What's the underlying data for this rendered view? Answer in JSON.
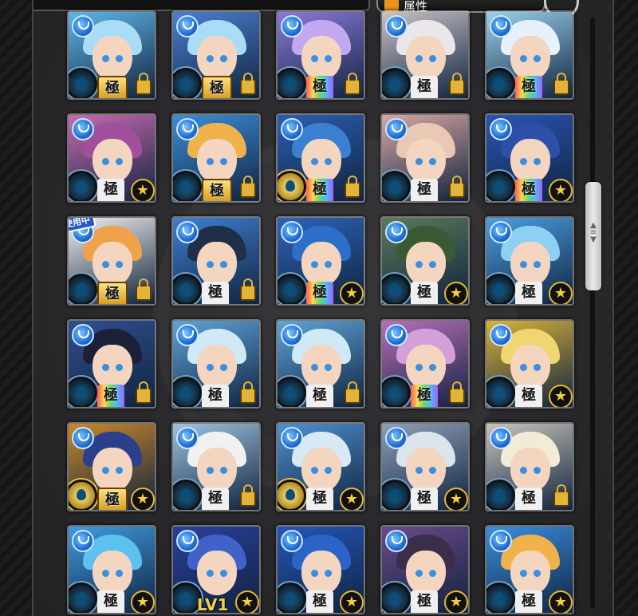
{
  "header": {
    "sort_label": "属性"
  },
  "colors": {
    "panel_bg": "#2b2b2e",
    "element_water": "#1f6dd6",
    "star": "#f6cf3a",
    "lock": "#e2b53a"
  },
  "monsters": [
    {
      "bg": "#5fb6e8",
      "hair": "#a9dcf7",
      "rank": "gold",
      "badge": "lock",
      "rank_label": "極"
    },
    {
      "bg": "#4d7fd0",
      "hair": "#a9dcf7",
      "rank": "gold",
      "badge": "lock",
      "rank_label": "極"
    },
    {
      "bg": "#8a7ad8",
      "hair": "#c2a8f0",
      "rank": "rainbow",
      "badge": "lock",
      "rank_label": "極"
    },
    {
      "bg": "#c7c2c6",
      "hair": "#eae6ea",
      "rank": "plain",
      "badge": "lock",
      "rank_label": "極"
    },
    {
      "bg": "#9ad0ec",
      "hair": "#e6f2fb",
      "rank": "rainbow",
      "badge": "lock",
      "rank_label": "極"
    },
    {
      "bg": "#c86bb0",
      "hair": "#a14f9c",
      "rank": "plain",
      "badge": "star",
      "rank_label": "極"
    },
    {
      "bg": "#3b8ed8",
      "hair": "#f0b24a",
      "rank": "gold",
      "badge": "lock",
      "rank_label": "極"
    },
    {
      "bg": "#2a5fb0",
      "hair": "#3a7fd0",
      "rank": "rainbow",
      "badge": "lock",
      "rank_label": "極",
      "gold_slot": true
    },
    {
      "bg": "#d8a7a3",
      "hair": "#e9c8b5",
      "rank": "plain",
      "badge": "lock",
      "rank_label": "極"
    },
    {
      "bg": "#2a55b5",
      "hair": "#2e4fa8",
      "rank": "rainbow",
      "badge": "star",
      "rank_label": "極"
    },
    {
      "bg": "#f1f1ef",
      "hair": "#f0a24a",
      "rank": "gold",
      "badge": "lock",
      "rank_label": "極",
      "in_use": true
    },
    {
      "bg": "#3f7fd0",
      "hair": "#1f2f4a",
      "rank": "plain",
      "badge": "lock",
      "rank_label": "極"
    },
    {
      "bg": "#2f63b8",
      "hair": "#2d6ec8",
      "rank": "rainbow",
      "badge": "star",
      "rank_label": "極"
    },
    {
      "bg": "#5b7a5a",
      "hair": "#3a5a34",
      "rank": "plain",
      "badge": "star",
      "rank_label": "極"
    },
    {
      "bg": "#4aa0e0",
      "hair": "#8dd0f4",
      "rank": "plain",
      "badge": "star",
      "rank_label": "極"
    },
    {
      "bg": "#2f4f90",
      "hair": "#1b2038",
      "rank": "rainbow",
      "badge": "lock",
      "rank_label": "極"
    },
    {
      "bg": "#5ea4d8",
      "hair": "#cfe9f7",
      "rank": "plain",
      "badge": "lock",
      "rank_label": "極"
    },
    {
      "bg": "#5ea4d8",
      "hair": "#cfe9f7",
      "rank": "plain",
      "badge": "lock",
      "rank_label": "極"
    },
    {
      "bg": "#b86fb8",
      "hair": "#d5a0d8",
      "rank": "rainbow",
      "badge": "lock",
      "rank_label": "極"
    },
    {
      "bg": "#d8b23a",
      "hair": "#f0d570",
      "rank": "plain",
      "badge": "star",
      "rank_label": "極"
    },
    {
      "bg": "#c8882a",
      "hair": "#2b3f8a",
      "rank": "gold",
      "badge": "star",
      "rank_label": "極",
      "gold_slot": true
    },
    {
      "bg": "#9fc3de",
      "hair": "#f1f1f1",
      "rank": "plain",
      "badge": "lock",
      "rank_label": "極"
    },
    {
      "bg": "#4f90d0",
      "hair": "#d8e8f4",
      "rank": "plain",
      "badge": "star",
      "rank_label": "極",
      "gold_slot": true
    },
    {
      "bg": "#8fa0b8",
      "hair": "#dce4ec",
      "rank": "plain",
      "badge": "star",
      "rank_label": "極"
    },
    {
      "bg": "#c8c4bc",
      "hair": "#f2ebd6",
      "rank": "plain",
      "badge": "lock",
      "rank_label": "極"
    },
    {
      "bg": "#3f9be0",
      "hair": "#5cc1ee",
      "rank": "plain",
      "badge": "star",
      "rank_label": "極"
    },
    {
      "bg": "#2b3f9a",
      "hair": "#4062c8",
      "rank": "plain",
      "badge": "star",
      "rank_label": "極",
      "level_text": "LV1"
    },
    {
      "bg": "#2456b8",
      "hair": "#2c63c8",
      "rank": "plain",
      "badge": "star",
      "rank_label": "極"
    },
    {
      "bg": "#6a4a8a",
      "hair": "#3a2e4a",
      "rank": "plain",
      "badge": "star",
      "rank_label": "極"
    },
    {
      "bg": "#3a8ee0",
      "hair": "#f0b24a",
      "rank": "plain",
      "badge": "star",
      "rank_label": "極"
    }
  ],
  "in_use_label": "使用中"
}
